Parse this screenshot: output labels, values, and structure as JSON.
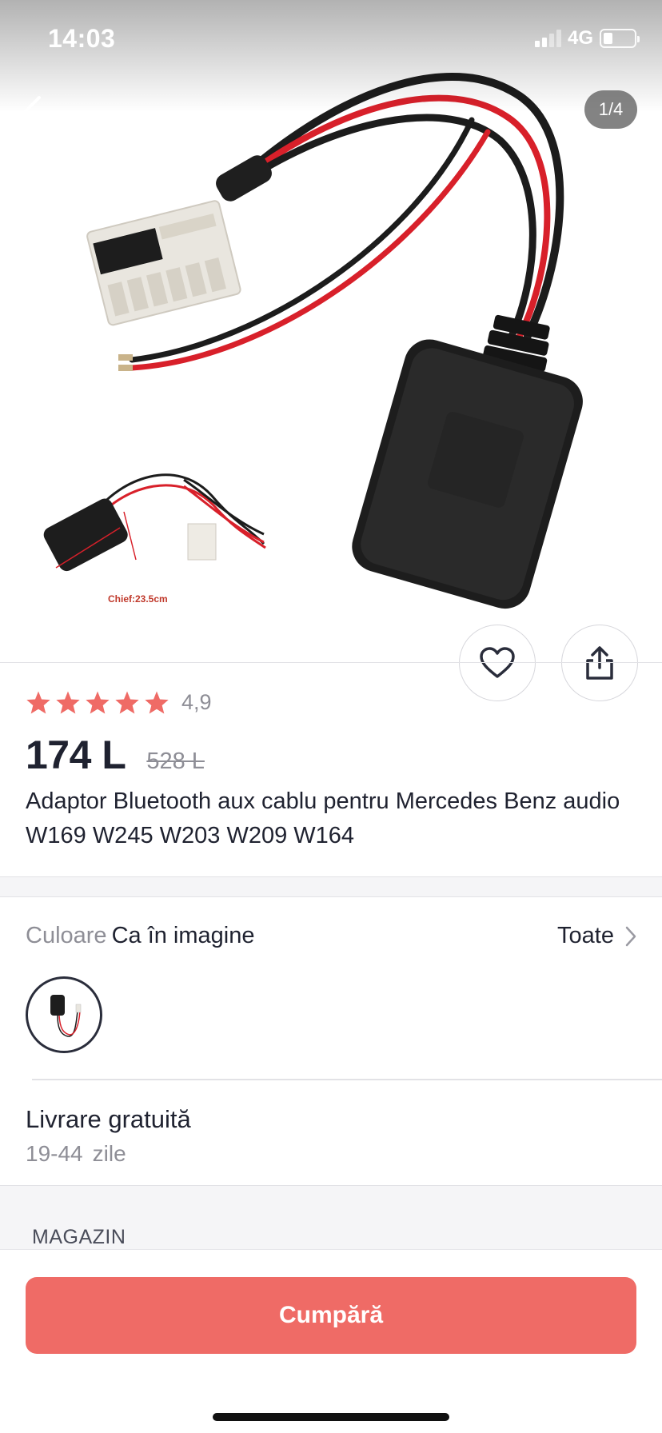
{
  "status_bar": {
    "time": "14:03",
    "network": "4G",
    "battery_level": 0.3
  },
  "gallery": {
    "counter": "1/4",
    "thumbnail_caption": "Chief:23.5cm"
  },
  "product": {
    "rating_value": "4,9",
    "stars": 5,
    "star_color": "#ef6b66",
    "price": "174 L",
    "old_price": "528 L",
    "title": "Adaptor Bluetooth aux cablu pentru Mercedes Benz audio W169 W245 W203 W209 W164"
  },
  "color": {
    "label": "Culoare",
    "value": "Ca în imagine",
    "all_label": "Toate"
  },
  "delivery": {
    "title": "Livrare gratuită",
    "days": "19-44",
    "unit": "zile"
  },
  "store": {
    "label": "MAGAZIN"
  },
  "actions": {
    "buy_label": "Cumpără",
    "accent_color": "#ef6b66"
  }
}
